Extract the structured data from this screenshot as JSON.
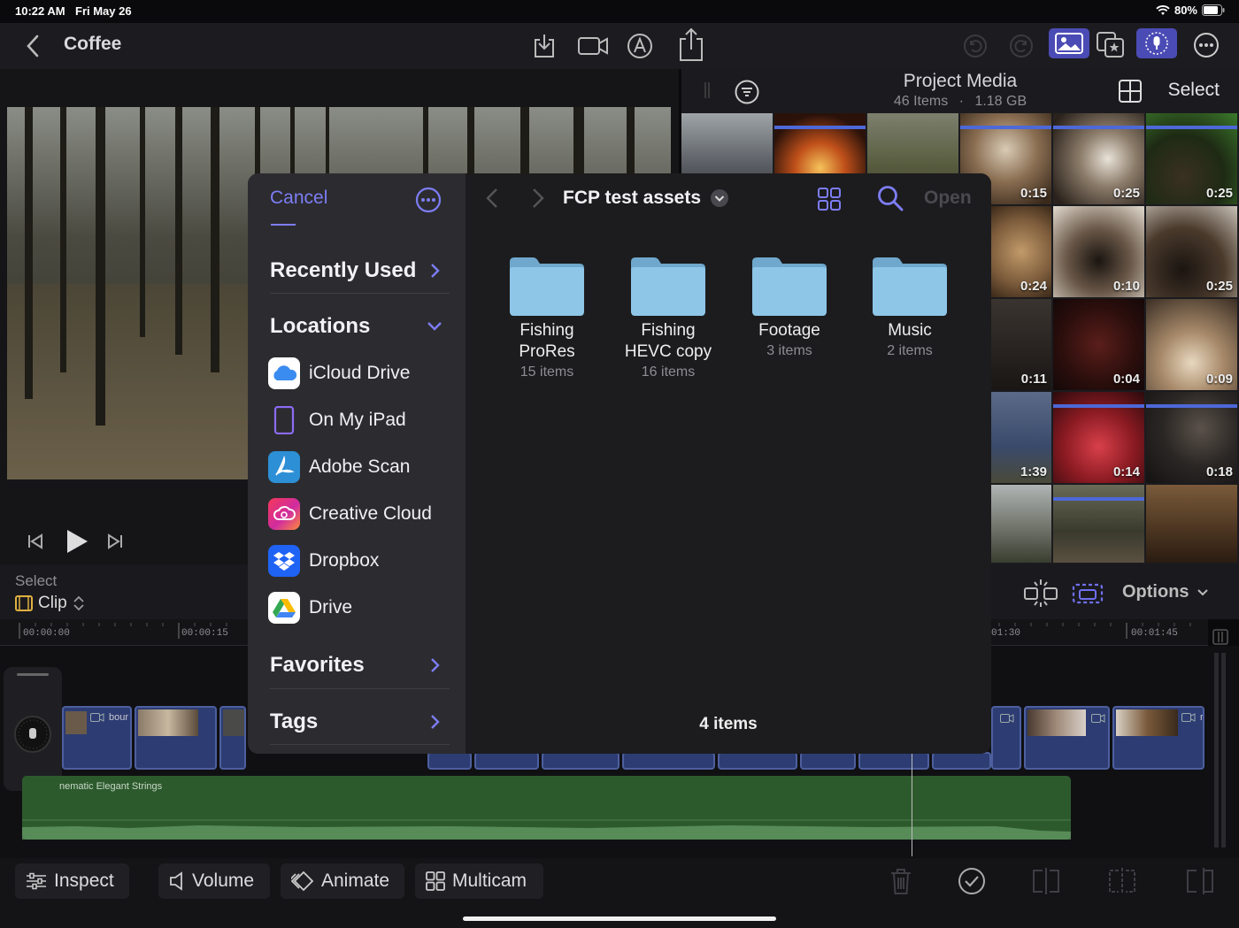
{
  "status": {
    "time": "10:22 AM",
    "date": "Fri May 26",
    "battery": "80%"
  },
  "project": {
    "title": "Coffee"
  },
  "media": {
    "title": "Project Media",
    "items": "46 Items",
    "sep": "·",
    "size": "1.18 GB",
    "select": "Select",
    "durations": [
      "0:15",
      "0:25",
      "0:25",
      "0:24",
      "0:10",
      "0:25",
      "0:11",
      "0:04",
      "0:09",
      "1:39",
      "0:14",
      "0:18"
    ]
  },
  "timeline": {
    "select_label": "Select",
    "clip_label": "Clip",
    "options_label": "Options",
    "ruler": [
      "00:00:00",
      "00:00:15",
      "01:30",
      "00:01:45"
    ],
    "clip_name": "bour",
    "clip_name_right": "r",
    "audio_name": "nematic Elegant Strings"
  },
  "picker": {
    "cancel": "Cancel",
    "path": "FCP test assets",
    "open": "Open",
    "recently_used": "Recently Used",
    "locations": "Locations",
    "favorites": "Favorites",
    "tags": "Tags",
    "location_items": [
      "iCloud Drive",
      "On My iPad",
      "Adobe Scan",
      "Creative Cloud",
      "Dropbox",
      "Drive"
    ],
    "folders": [
      {
        "name_line1": "Fishing",
        "name_line2": "ProRes",
        "count": "15 items"
      },
      {
        "name_line1": "Fishing",
        "name_line2": "HEVC copy",
        "count": "16 items"
      },
      {
        "name_line1": "Footage",
        "name_line2": "",
        "count": "3 items"
      },
      {
        "name_line1": "Music",
        "name_line2": "",
        "count": "2 items"
      }
    ],
    "footer": "4 items"
  },
  "toolbar": {
    "inspect": "Inspect",
    "volume": "Volume",
    "animate": "Animate",
    "multicam": "Multicam"
  },
  "colors": {
    "accent": "#7d7df5",
    "folder": "#8ec6e8",
    "clip": "#2d3c72",
    "audio": "#2d5a2d",
    "active_tab": "#4b4bb5"
  }
}
